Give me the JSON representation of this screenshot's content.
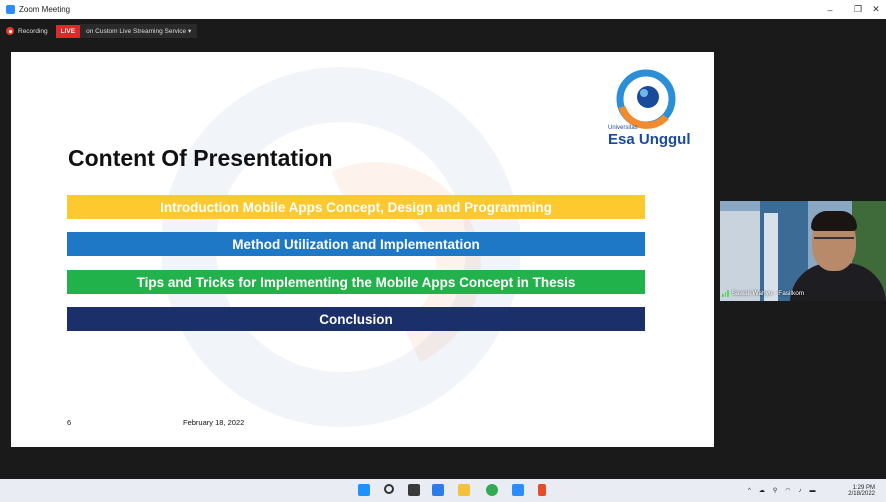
{
  "window": {
    "title": "Zoom Meeting",
    "controls": [
      "–",
      "❐",
      "✕"
    ]
  },
  "recording": {
    "recording_label": "Recording",
    "live_badge": "LIVE",
    "stream_label": "on Custom Live Streaming Service ▾"
  },
  "slide": {
    "logo": {
      "univ": "Universitas",
      "name": "Esa Unggul"
    },
    "title": "Content Of Presentation",
    "items": [
      {
        "label": "Introduction Mobile Apps Concept, Design and Programming",
        "color": "#fdc92f"
      },
      {
        "label": "Method Utilization and Implementation",
        "color": "#1f78c6"
      },
      {
        "label": "Tips and Tricks for Implementing the Mobile Apps Concept in Thesis",
        "color": "#22b24c"
      },
      {
        "label": "Conclusion",
        "color": "#1b2f6b"
      }
    ],
    "page_number": "6",
    "date": "February 18, 2022"
  },
  "participant": {
    "name": "Sawali Wahyu - Fasilkom"
  },
  "taskbar": {
    "time": "1:29 PM",
    "date": "2/18/2022"
  },
  "colors": {
    "accent": "#2d8cff",
    "live": "#e02828"
  }
}
